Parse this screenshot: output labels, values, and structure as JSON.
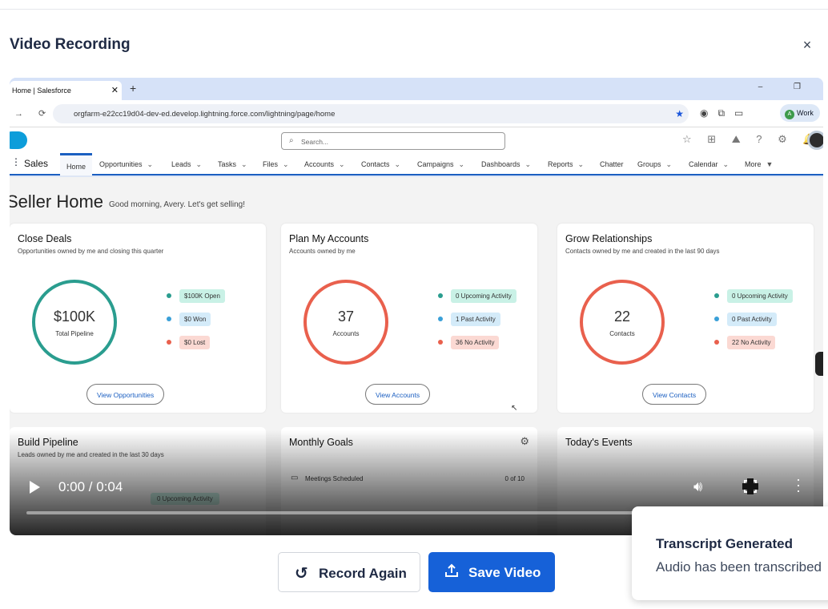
{
  "modal": {
    "title": "Video Recording",
    "close_label": "×"
  },
  "browser": {
    "tab_title": "Home | Salesforce",
    "tab_close": "✕",
    "new_tab": "+",
    "window_controls": "–   ❐",
    "url": "orgfarm-e22cc19d04-dev-ed.develop.lightning.force.com/lightning/page/home",
    "profile_label": "Work",
    "profile_initial": "A"
  },
  "salesforce": {
    "search_placeholder": "Search...",
    "app_name": "Sales",
    "nav": [
      {
        "label": "Home",
        "chev": ""
      },
      {
        "label": "Opportunities",
        "chev": "⌄"
      },
      {
        "label": "Leads",
        "chev": "⌄"
      },
      {
        "label": "Tasks",
        "chev": "⌄"
      },
      {
        "label": "Files",
        "chev": "⌄"
      },
      {
        "label": "Accounts",
        "chev": "⌄"
      },
      {
        "label": "Contacts",
        "chev": "⌄"
      },
      {
        "label": "Campaigns",
        "chev": "⌄"
      },
      {
        "label": "Dashboards",
        "chev": "⌄"
      },
      {
        "label": "Reports",
        "chev": "⌄"
      },
      {
        "label": "Chatter",
        "chev": ""
      },
      {
        "label": "Groups",
        "chev": "⌄"
      },
      {
        "label": "Calendar",
        "chev": "⌄"
      },
      {
        "label": "More",
        "chev": "▼"
      }
    ],
    "page_title": "Seller Home",
    "greeting": "Good morning, Avery. Let's get selling!",
    "cards": [
      {
        "title": "Close Deals",
        "subtitle": "Opportunities owned by me and closing this quarter",
        "value": "$100K",
        "value_label": "Total Pipeline",
        "ring_color": "#2a9d8f",
        "legend": [
          {
            "text": "$100K Open",
            "dot": "#2a9d8f",
            "bg": "#c9f1e6"
          },
          {
            "text": "$0 Won",
            "dot": "#3aa0d8",
            "bg": "#d4ebf9"
          },
          {
            "text": "$0 Lost",
            "dot": "#e9604d",
            "bg": "#fbd9d3"
          }
        ],
        "button": "View Opportunities"
      },
      {
        "title": "Plan My Accounts",
        "subtitle": "Accounts owned by me",
        "value": "37",
        "value_label": "Accounts",
        "ring_color": "#e9604d",
        "legend": [
          {
            "text": "0 Upcoming Activity",
            "dot": "#2a9d8f",
            "bg": "#c9f1e6"
          },
          {
            "text": "1 Past Activity",
            "dot": "#3aa0d8",
            "bg": "#d4ebf9"
          },
          {
            "text": "36 No Activity",
            "dot": "#e9604d",
            "bg": "#fbd9d3"
          }
        ],
        "button": "View Accounts"
      },
      {
        "title": "Grow Relationships",
        "subtitle": "Contacts owned by me and created in the last 90 days",
        "value": "22",
        "value_label": "Contacts",
        "ring_color": "#e9604d",
        "legend": [
          {
            "text": "0 Upcoming Activity",
            "dot": "#2a9d8f",
            "bg": "#c9f1e6"
          },
          {
            "text": "0 Past Activity",
            "dot": "#3aa0d8",
            "bg": "#d4ebf9"
          },
          {
            "text": "22 No Activity",
            "dot": "#e9604d",
            "bg": "#fbd9d3"
          }
        ],
        "button": "View Contacts"
      }
    ],
    "bottom_cards": [
      {
        "title": "Build Pipeline",
        "subtitle": "Leads owned by me and created in the last 30 days",
        "extra": "0 Upcoming Activity"
      },
      {
        "title": "Monthly Goals",
        "subtitle": "",
        "extra": "Meetings Scheduled",
        "extra_value": "0 of 10"
      },
      {
        "title": "Today's Events",
        "subtitle": "",
        "extra": ""
      }
    ]
  },
  "player": {
    "time": "0:00 / 0:04",
    "progress": 0
  },
  "actions": {
    "record_again": "Record Again",
    "save_video": "Save Video"
  },
  "toast": {
    "title": "Transcript Generated",
    "message": "Audio has been transcribed"
  }
}
